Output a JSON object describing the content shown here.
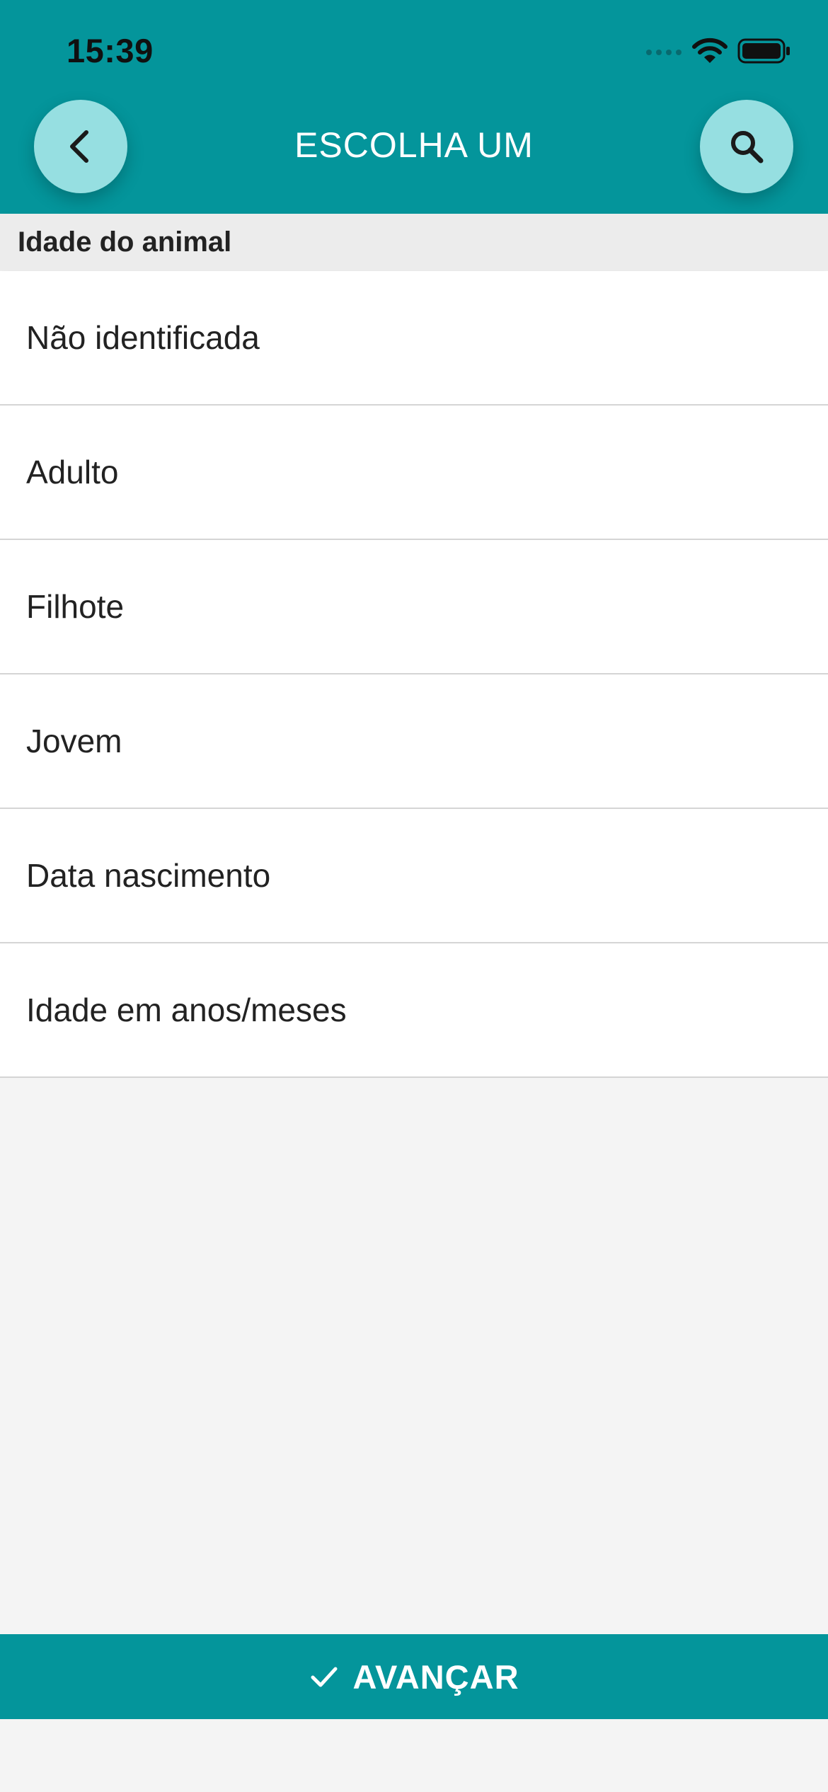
{
  "status_bar": {
    "time": "15:39",
    "signal_icon": "cellular-signal-icon",
    "wifi_icon": "wifi-icon",
    "battery_icon": "battery-icon"
  },
  "header": {
    "title": "ESCOLHA UM",
    "back_icon": "chevron-left-icon",
    "search_icon": "search-icon",
    "background_color": "#04959b",
    "button_color": "#96dfe1"
  },
  "section": {
    "label": "Idade do animal"
  },
  "options": [
    {
      "label": "Não identificada"
    },
    {
      "label": "Adulto"
    },
    {
      "label": "Filhote"
    },
    {
      "label": "Jovem"
    },
    {
      "label": "Data nascimento"
    },
    {
      "label": "Idade em anos/meses"
    }
  ],
  "footer": {
    "button_label": "AVANÇAR",
    "button_icon": "checkmark-icon"
  }
}
